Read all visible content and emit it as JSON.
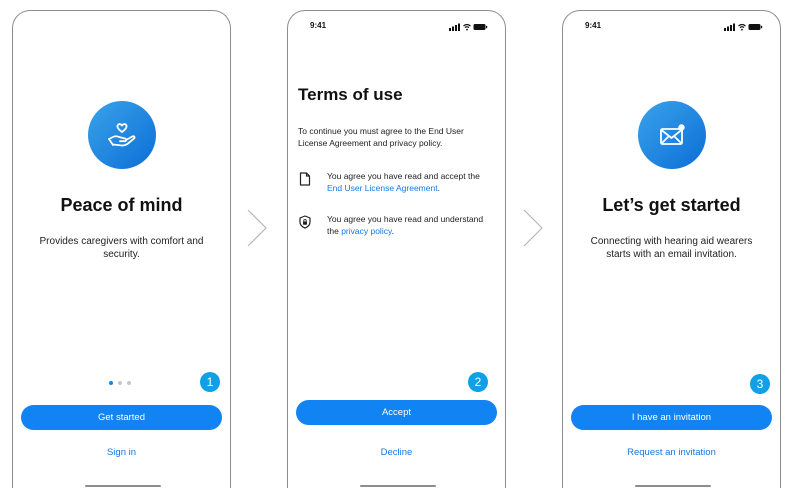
{
  "status_bar": {
    "time": "9:41"
  },
  "screen1": {
    "title": "Peace of mind",
    "description": "Provides caregivers with comfort and security.",
    "primary_button": "Get started",
    "secondary_link": "Sign in",
    "step_badge": "1",
    "page_indicator": {
      "count": 3,
      "active": 1
    },
    "icon": "heart-hand-icon"
  },
  "screen2": {
    "title": "Terms of use",
    "intro": "To continue you must agree to the End User License Agreement and privacy policy.",
    "items": [
      {
        "icon": "document-icon",
        "text": "You agree you have read and accept the ",
        "link": "End User License Agreement",
        "suffix": "."
      },
      {
        "icon": "shield-lock-icon",
        "text": "You agree you have read and understand the ",
        "link": "privacy policy",
        "suffix": "."
      }
    ],
    "primary_button": "Accept",
    "secondary_link": "Decline",
    "step_badge": "2"
  },
  "screen3": {
    "title": "Let’s get started",
    "description": "Connecting with hearing aid wearers starts with an email invitation.",
    "primary_button": "I have an invitation",
    "secondary_link": "Request an invitation",
    "step_badge": "3",
    "icon": "envelope-notification-icon"
  },
  "colors": {
    "accent": "#1283f2",
    "link": "#1677e8",
    "badge": "#11a0e6",
    "icon_gradient_start": "#3aa2ea",
    "icon_gradient_end": "#0b6fd6"
  }
}
